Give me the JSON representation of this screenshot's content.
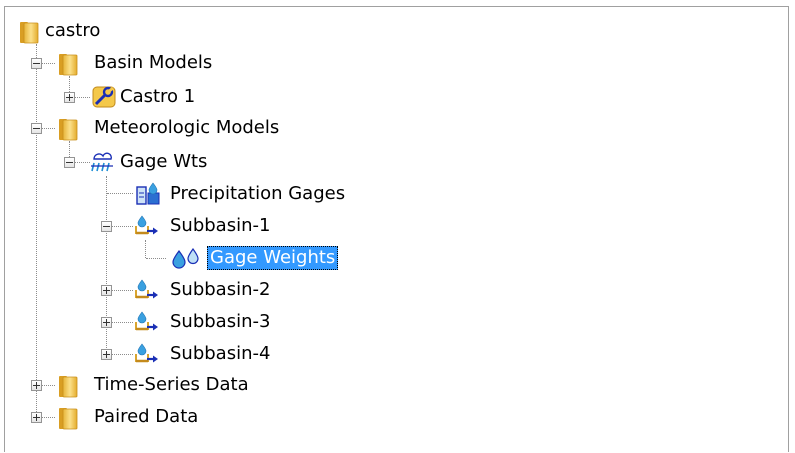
{
  "tree": {
    "root": {
      "label": "castro",
      "icon": "folder-icon"
    },
    "basin_models": {
      "label": "Basin Models",
      "icon": "folder-icon",
      "expanded": true
    },
    "castro1": {
      "label": "Castro 1",
      "icon": "basin-model-icon",
      "expanded": false
    },
    "meteorologic_models": {
      "label": "Meteorologic Models",
      "icon": "folder-icon",
      "expanded": true
    },
    "gage_wts": {
      "label": "Gage Wts",
      "icon": "meteorologic-model-icon",
      "expanded": true
    },
    "precipitation_gages": {
      "label": "Precipitation Gages",
      "icon": "precipitation-gages-icon"
    },
    "subbasin1": {
      "label": "Subbasin-1",
      "icon": "subbasin-icon",
      "expanded": true
    },
    "gage_weights": {
      "label": "Gage Weights",
      "icon": "gage-weights-icon",
      "selected": true
    },
    "subbasin2": {
      "label": "Subbasin-2",
      "icon": "subbasin-icon",
      "expanded": false
    },
    "subbasin3": {
      "label": "Subbasin-3",
      "icon": "subbasin-icon",
      "expanded": false
    },
    "subbasin4": {
      "label": "Subbasin-4",
      "icon": "subbasin-icon",
      "expanded": false
    },
    "time_series": {
      "label": "Time-Series Data",
      "icon": "folder-icon",
      "expanded": false
    },
    "paired_data": {
      "label": "Paired Data",
      "icon": "folder-icon",
      "expanded": false
    }
  },
  "colors": {
    "selection": "#3399ff",
    "folder": "#f2c040",
    "water": "#1e8fd6",
    "arrow": "#1a2fb5"
  }
}
